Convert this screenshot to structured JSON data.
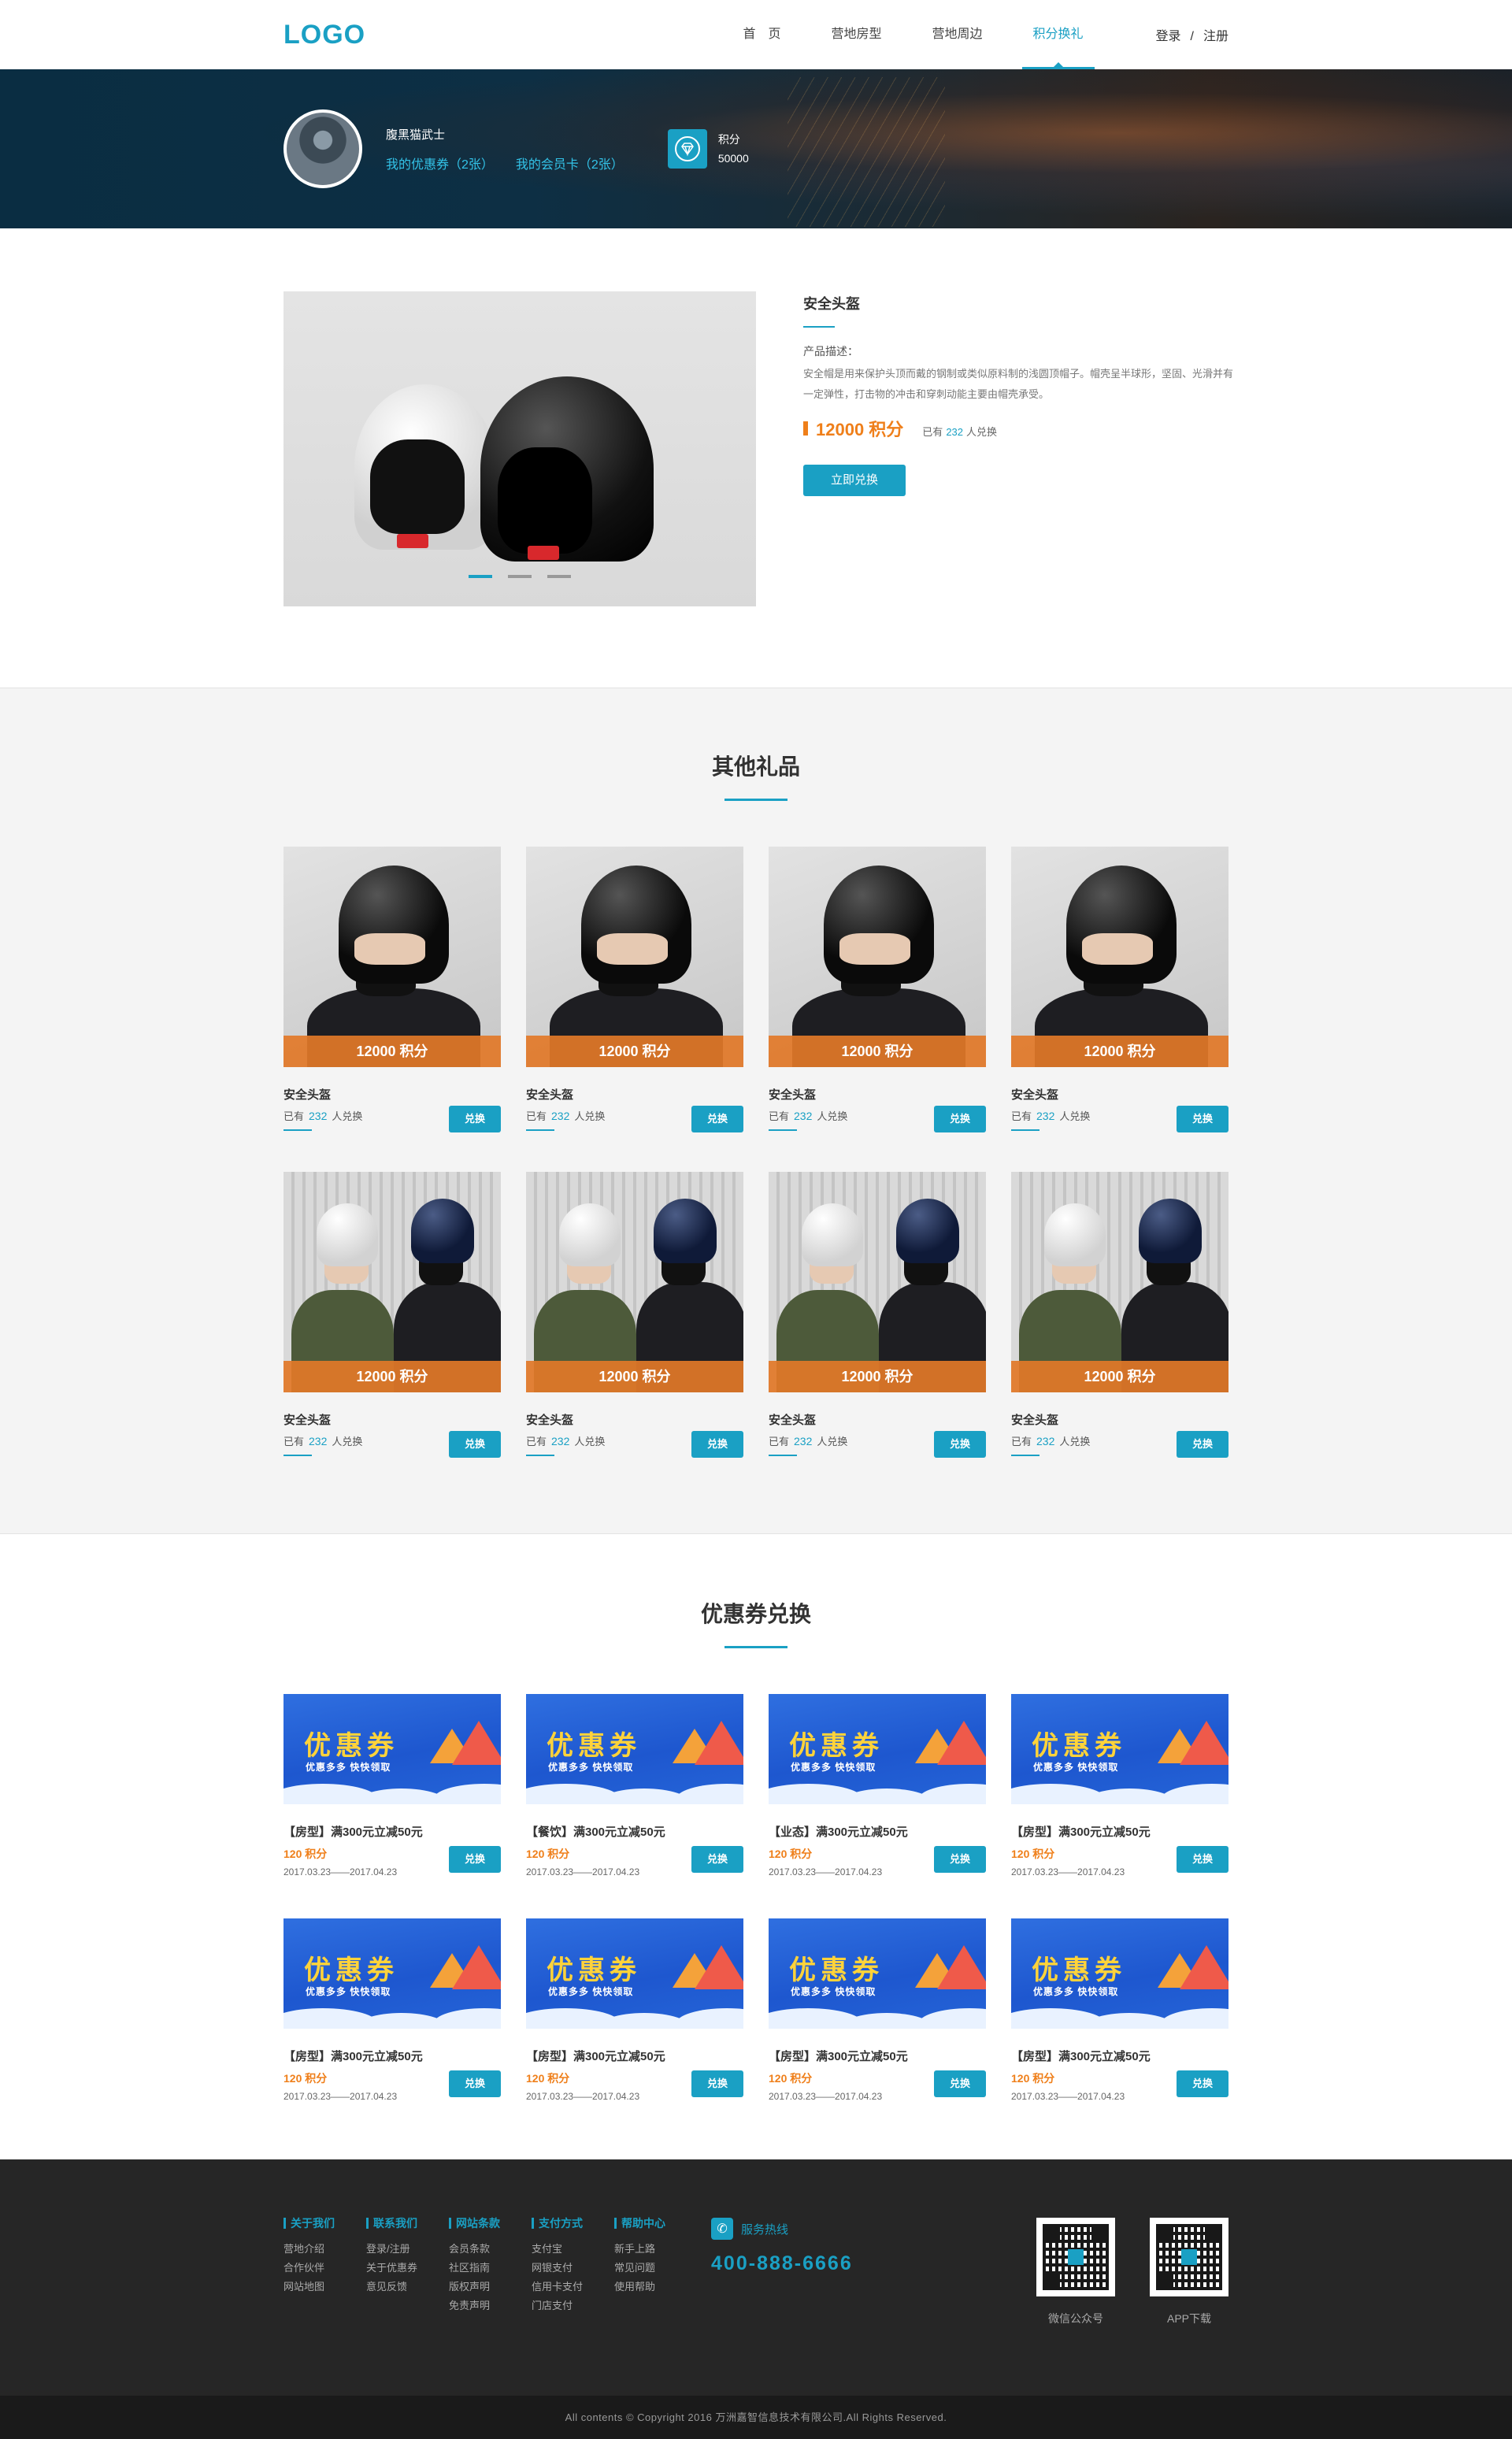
{
  "header": {
    "logo": "LOGO",
    "nav": [
      "首　页",
      "营地房型",
      "营地周边",
      "积分换礼"
    ],
    "login": "登录",
    "separator": "/",
    "register": "注册"
  },
  "banner": {
    "username": "腹黑猫武士",
    "coupons_link": "我的优惠券（2张）",
    "cards_link": "我的会员卡（2张）",
    "points_label": "积分",
    "points_value": "50000"
  },
  "product": {
    "title": "安全头盔",
    "desc_label": "产品描述：",
    "desc": "安全帽是用来保护头顶而戴的钢制或类似原料制的浅圆顶帽子。帽壳呈半球形，坚固、光滑并有一定弹性，打击物的冲击和穿刺动能主要由帽壳承受。",
    "price": "12000 积分",
    "exchanged_prefix": "已有",
    "exchanged_count": "232",
    "exchanged_suffix": "人兑换",
    "button": "立即兑换"
  },
  "gifts": {
    "title": "其他礼品",
    "items": [
      {
        "strip": "12000 积分",
        "name": "安全头盔",
        "prefix": "已有",
        "count": "232",
        "suffix": "人兑换",
        "button": "兑换"
      },
      {
        "strip": "12000 积分",
        "name": "安全头盔",
        "prefix": "已有",
        "count": "232",
        "suffix": "人兑换",
        "button": "兑换"
      },
      {
        "strip": "12000 积分",
        "name": "安全头盔",
        "prefix": "已有",
        "count": "232",
        "suffix": "人兑换",
        "button": "兑换"
      },
      {
        "strip": "12000 积分",
        "name": "安全头盔",
        "prefix": "已有",
        "count": "232",
        "suffix": "人兑换",
        "button": "兑换"
      },
      {
        "strip": "12000 积分",
        "name": "安全头盔",
        "prefix": "已有",
        "count": "232",
        "suffix": "人兑换",
        "button": "兑换"
      },
      {
        "strip": "12000 积分",
        "name": "安全头盔",
        "prefix": "已有",
        "count": "232",
        "suffix": "人兑换",
        "button": "兑换"
      },
      {
        "strip": "12000 积分",
        "name": "安全头盔",
        "prefix": "已有",
        "count": "232",
        "suffix": "人兑换",
        "button": "兑换"
      },
      {
        "strip": "12000 积分",
        "name": "安全头盔",
        "prefix": "已有",
        "count": "232",
        "suffix": "人兑换",
        "button": "兑换"
      }
    ]
  },
  "coupons": {
    "title": "优惠券兑换",
    "banner_big": "优惠券",
    "banner_small": "优惠多多  快快领取",
    "items": [
      {
        "title": "【房型】满300元立减50元",
        "points": "120 积分",
        "date": "2017.03.23——2017.04.23",
        "button": "兑换"
      },
      {
        "title": "【餐饮】满300元立减50元",
        "points": "120 积分",
        "date": "2017.03.23——2017.04.23",
        "button": "兑换"
      },
      {
        "title": "【业态】满300元立减50元",
        "points": "120 积分",
        "date": "2017.03.23——2017.04.23",
        "button": "兑换"
      },
      {
        "title": "【房型】满300元立减50元",
        "points": "120 积分",
        "date": "2017.03.23——2017.04.23",
        "button": "兑换"
      },
      {
        "title": "【房型】满300元立减50元",
        "points": "120 积分",
        "date": "2017.03.23——2017.04.23",
        "button": "兑换"
      },
      {
        "title": "【房型】满300元立减50元",
        "points": "120 积分",
        "date": "2017.03.23——2017.04.23",
        "button": "兑换"
      },
      {
        "title": "【房型】满300元立减50元",
        "points": "120 积分",
        "date": "2017.03.23——2017.04.23",
        "button": "兑换"
      },
      {
        "title": "【房型】满300元立减50元",
        "points": "120 积分",
        "date": "2017.03.23——2017.04.23",
        "button": "兑换"
      }
    ]
  },
  "footer": {
    "columns": [
      {
        "title": "关于我们",
        "links": [
          "营地介绍",
          "合作伙伴",
          "网站地图"
        ]
      },
      {
        "title": "联系我们",
        "links": [
          "登录/注册",
          "关于优惠券",
          "意见反馈"
        ]
      },
      {
        "title": "网站条款",
        "links": [
          "会员条款",
          "社区指南",
          "版权声明",
          "免责声明"
        ]
      },
      {
        "title": "支付方式",
        "links": [
          "支付宝",
          "网银支付",
          "信用卡支付",
          "门店支付"
        ]
      },
      {
        "title": "帮助中心",
        "links": [
          "新手上路",
          "常见问题",
          "使用帮助"
        ]
      }
    ],
    "hotline_label": "服务热线",
    "hotline_number": "400-888-6666",
    "qr_wechat": "微信公众号",
    "qr_app": "APP下载",
    "copyright": "All contents © Copyright 2016 万洲嘉智信息技术有限公司.All Rights Reserved."
  },
  "colors": {
    "accent": "#1aa0c4",
    "orange": "#ef7f1a",
    "footer_bg": "#262626"
  }
}
